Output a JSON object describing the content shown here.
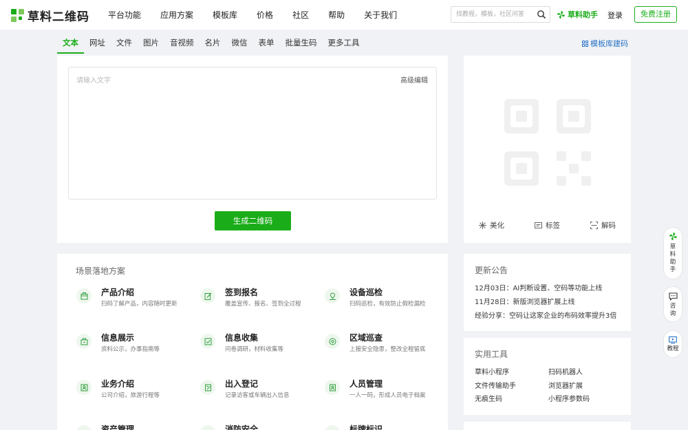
{
  "header": {
    "brand": "草料二维码",
    "nav": [
      "平台功能",
      "应用方案",
      "模板库",
      "价格",
      "社区",
      "帮助",
      "关于我们"
    ],
    "search_placeholder": "找教程，模板，社区问答",
    "helper": "草料助手",
    "login": "登录",
    "register": "免费注册"
  },
  "tabs": [
    "文本",
    "网址",
    "文件",
    "图片",
    "音视频",
    "名片",
    "微信",
    "表单",
    "批量生码",
    "更多工具"
  ],
  "active_tab": "文本",
  "template_link": "模板库建码",
  "editor": {
    "placeholder": "请输入文字",
    "advanced": "高级编辑",
    "generate": "生成二维码"
  },
  "qr_actions": [
    "美化",
    "标签",
    "解码"
  ],
  "scenarios": {
    "title": "场景落地方案",
    "items": [
      {
        "title": "产品介绍",
        "desc": "扫码了解产品，内容随时更新",
        "icon": "box-icon"
      },
      {
        "title": "签到报名",
        "desc": "覆盖宣传、报名、签到全过程",
        "icon": "edit-icon"
      },
      {
        "title": "设备巡检",
        "desc": "扫码巡检，有效防止假检漏检",
        "icon": "location-icon"
      },
      {
        "title": "信息展示",
        "desc": "资料公示，办事指南等",
        "icon": "briefcase-icon"
      },
      {
        "title": "信息收集",
        "desc": "问卷调研，材料收集等",
        "icon": "checklist-icon"
      },
      {
        "title": "区域巡查",
        "desc": "上报安全隐患，整改全程留底",
        "icon": "pin-icon"
      },
      {
        "title": "业务介绍",
        "desc": "公司介绍，旅游行程等",
        "icon": "contact-icon"
      },
      {
        "title": "出入登记",
        "desc": "记录访客或车辆出入信息",
        "icon": "register-icon"
      },
      {
        "title": "人员管理",
        "desc": "一人一码，形成人员电子档案",
        "icon": "person-card-icon"
      },
      {
        "title": "资产管理",
        "desc": "",
        "icon": "asset-icon"
      },
      {
        "title": "消防安全",
        "desc": "",
        "icon": "fire-icon"
      },
      {
        "title": "标牌标识",
        "desc": "",
        "icon": "sign-icon"
      }
    ]
  },
  "notices": {
    "title": "更新公告",
    "lines": [
      "12月03日：AI判断设置、空码等功能上线",
      "11月28日：新版浏览器扩展上线",
      "经验分享：空码让这家企业的布码效率提升3倍"
    ]
  },
  "tools": {
    "title": "实用工具",
    "items": [
      "草料小程序",
      "扫码机器人",
      "文件传输助手",
      "浏览器扩展",
      "无痕生码",
      "小程序参数码"
    ]
  },
  "float_bar": {
    "helper": "草料助手",
    "consult": "咨询",
    "tutorial": "教程"
  },
  "colors": {
    "brand_green": "#1aad19",
    "link_blue": "#2a73c6",
    "background": "#f0f2f5"
  }
}
